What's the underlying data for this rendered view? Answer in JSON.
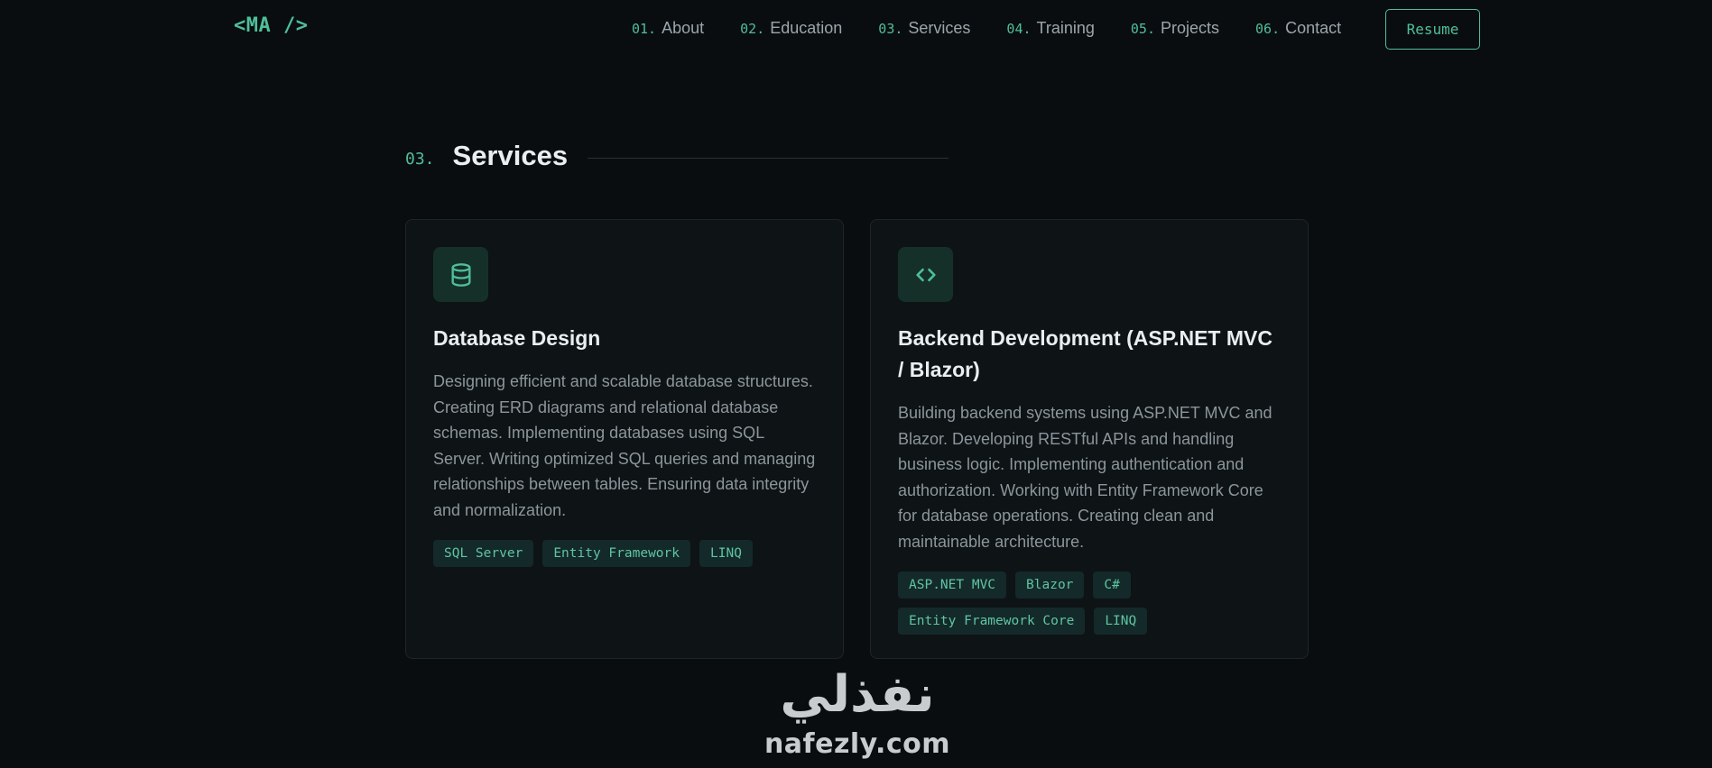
{
  "nav": {
    "logo": "<MA />",
    "links": [
      {
        "num": "01.",
        "label": "About"
      },
      {
        "num": "02.",
        "label": "Education"
      },
      {
        "num": "03.",
        "label": "Services"
      },
      {
        "num": "04.",
        "label": "Training"
      },
      {
        "num": "05.",
        "label": "Projects"
      },
      {
        "num": "06.",
        "label": "Contact"
      }
    ],
    "resume_label": "Resume"
  },
  "section": {
    "num": "03.",
    "title": "Services"
  },
  "cards": [
    {
      "icon": "database-icon",
      "title": "Database Design",
      "description": "Designing efficient and scalable database structures. Creating ERD diagrams and relational database schemas. Implementing databases using SQL Server. Writing optimized SQL queries and managing relationships between tables. Ensuring data integrity and normalization.",
      "tags": [
        "SQL Server",
        "Entity Framework",
        "LINQ"
      ]
    },
    {
      "icon": "code-brackets-icon",
      "title": "Backend Development (ASP.NET MVC / Blazor)",
      "description": "Building backend systems using ASP.NET MVC and Blazor. Developing RESTful APIs and handling business logic. Implementing authentication and authorization. Working with Entity Framework Core for database operations. Creating clean and maintainable architecture.",
      "tags": [
        "ASP.NET MVC",
        "Blazor",
        "C#",
        "Entity Framework Core",
        "LINQ"
      ]
    }
  ],
  "watermark": {
    "arabic": "نفذلي",
    "latin": "nafezly.com"
  },
  "colors": {
    "background": "#0a0d0f",
    "accent": "#4fbf99",
    "card_bg": "#0e1315",
    "tag_bg": "#14292a",
    "muted_text": "#8b969c"
  }
}
